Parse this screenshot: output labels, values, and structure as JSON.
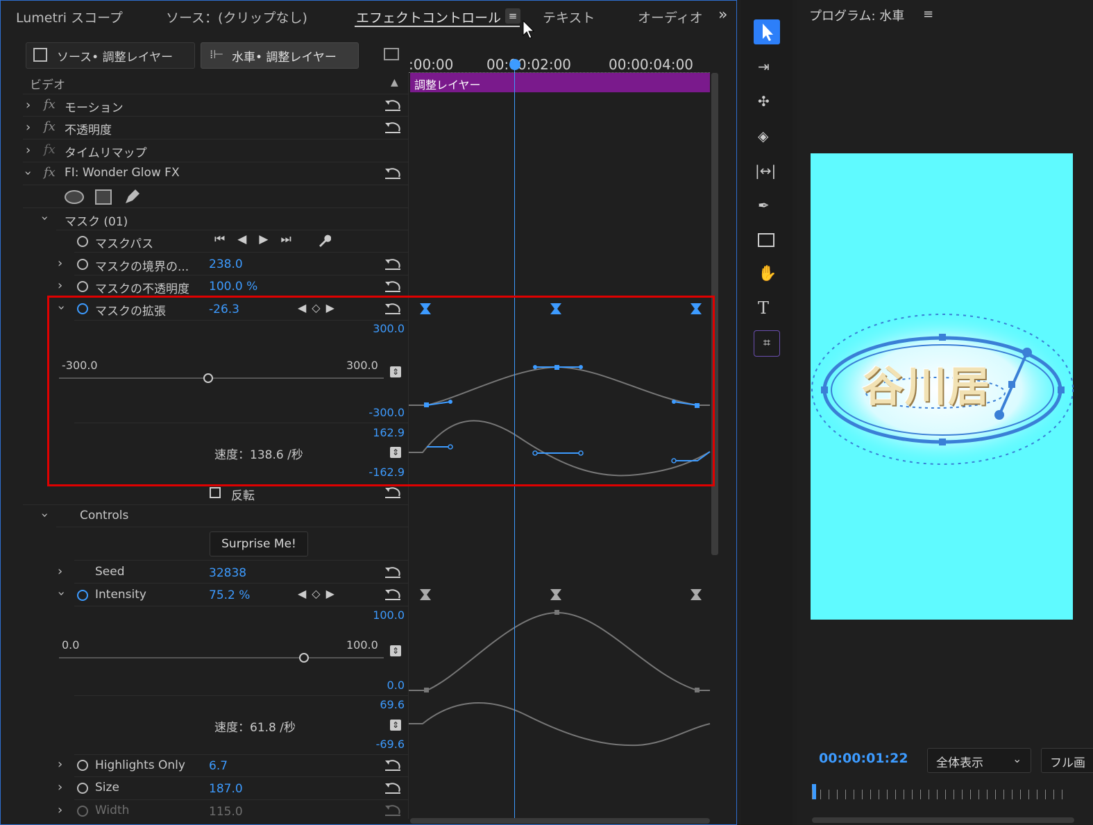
{
  "tabs": {
    "lumetri": "Lumetri スコープ",
    "source": "ソース：(クリップなし)",
    "effect_controls": "エフェクトコントロール",
    "text": "テキスト",
    "audio": "オーディオ"
  },
  "clip_tabs": {
    "source": "ソース• 調整レイヤー",
    "sequence": "水車• 調整レイヤー"
  },
  "timeline": {
    "t0": ":00:00",
    "t1": "00:00:02:00",
    "t2": "00:00:04:00",
    "clip_label": "調整レイヤー"
  },
  "section": {
    "video": "ビデオ"
  },
  "effects": {
    "motion": "モーション",
    "opacity": "不透明度",
    "timeremap": "タイムリマップ",
    "wonder": "FI: Wonder Glow FX"
  },
  "mask": {
    "title": "マスク (01)",
    "path": "マスクパス",
    "feather_label": "マスクの境界の...",
    "feather_value": "238.0",
    "opacity_label": "マスクの不透明度",
    "opacity_value": "100.0 %",
    "expansion_label": "マスクの拡張",
    "expansion_value": "-26.3",
    "graph_max": "300.0",
    "graph_min": "-300.0",
    "slider_min": "-300.0",
    "slider_max": "300.0",
    "velocity_max": "162.9",
    "velocity_min": "-162.9",
    "velocity_text": "速度：138.6 /秒",
    "invert_label": "反転"
  },
  "controls": {
    "title": "Controls",
    "surprise": "Surprise Me!",
    "seed_label": "Seed",
    "seed_value": "32838",
    "intensity_label": "Intensity",
    "intensity_value": "75.2 %",
    "int_graph_max": "100.0",
    "int_graph_min": "0.0",
    "int_slider_min": "0.0",
    "int_slider_max": "100.0",
    "int_vel_max": "69.6",
    "int_vel_min": "-69.6",
    "int_velocity_text": "速度：61.8 /秒",
    "highlights_label": "Highlights Only",
    "highlights_value": "6.7",
    "size_label": "Size",
    "size_value": "187.0",
    "width_label": "Width",
    "width_value": "115.0"
  },
  "program": {
    "title": "プログラム: 水車",
    "timecode": "00:00:01:22",
    "zoom": "全体表示",
    "full": "フル画"
  },
  "preview_text": "谷川居",
  "colors": {
    "accent": "#3d9bff",
    "clip": "#7a1a8c",
    "preview_bg": "#5ffaff",
    "highlight": "#e00000"
  }
}
